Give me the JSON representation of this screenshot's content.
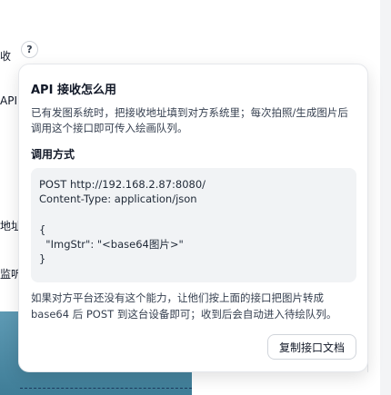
{
  "background": {
    "label_receive": "收",
    "label_api": "API",
    "label_address": "地址",
    "label_listen": "监听",
    "help_glyph": "?"
  },
  "popover": {
    "title": "API 接收怎么用",
    "description": "已有发图系统时，把接收地址填到对方系统里；每次拍照/生成图片后调用这个接口即可传入绘画队列。",
    "subtitle": "调用方式",
    "code_lines": [
      "POST http://192.168.2.87:8080/",
      "Content-Type: application/json",
      "",
      "{",
      "  \"ImgStr\": \"<base64图片>\"",
      "}"
    ],
    "note": "如果对方平台还没有这个能力，让他们按上面的接口把图片转成 base64 后 POST 到这台设备即可；收到后会自动进入待绘队列。",
    "copy_button": "复制接口文档"
  }
}
